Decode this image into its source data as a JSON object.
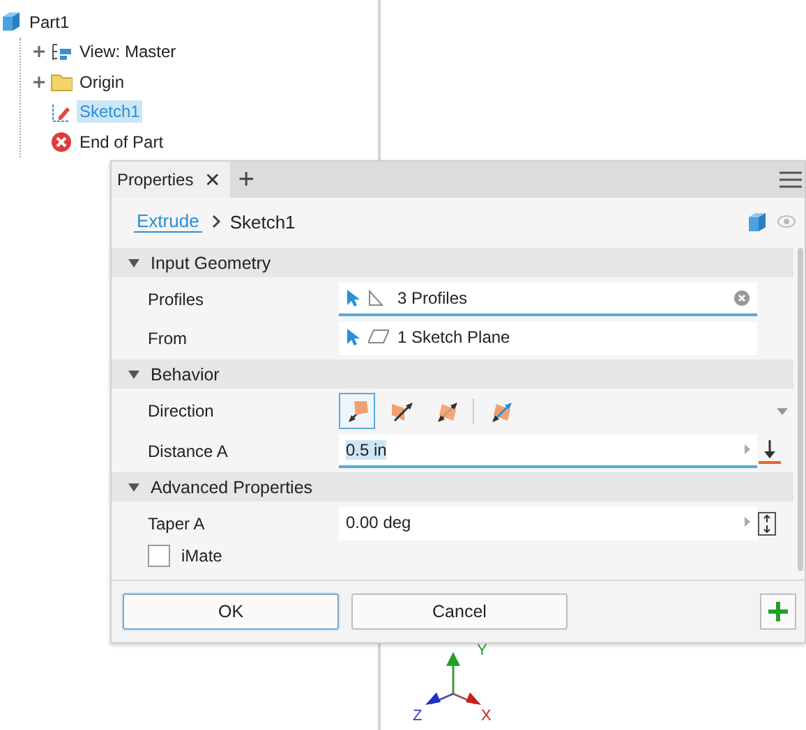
{
  "browser": {
    "tree": {
      "label": "Part1",
      "kind": "part",
      "children": [
        {
          "label": "View: Master",
          "kind": "view",
          "expanded": false,
          "selected": false
        },
        {
          "label": "Origin",
          "kind": "folder",
          "expanded": false,
          "selected": false
        },
        {
          "label": "Sketch1",
          "kind": "sketch",
          "selected": true
        },
        {
          "label": "End of Part",
          "kind": "end",
          "selected": false
        }
      ]
    }
  },
  "properties": {
    "tab": {
      "label": "Properties",
      "close": "✕",
      "add": "+"
    },
    "breadcrumb": {
      "link": "Extrude",
      "current": "Sketch1"
    },
    "sections": [
      {
        "title": "Input Geometry",
        "expanded": true,
        "rows": [
          {
            "kind": "profile-selector",
            "label": "Profiles",
            "value": "3 Profiles",
            "active": true
          },
          {
            "kind": "plane-selector",
            "label": "From",
            "value": "1 Sketch Plane",
            "active": false
          }
        ]
      },
      {
        "title": "Behavior",
        "expanded": true,
        "rows": [
          {
            "kind": "direction",
            "label": "Direction",
            "options": [
              {
                "kind": "default",
                "selected": true
              },
              {
                "kind": "flipped",
                "selected": false
              },
              {
                "kind": "symmetric",
                "selected": false
              },
              {
                "kind": "asymmetric",
                "selected": false
              }
            ]
          },
          {
            "kind": "distance",
            "label": "Distance A",
            "value": "0.5 in",
            "active": true
          }
        ]
      },
      {
        "title": "Advanced Properties",
        "expanded": true,
        "rows": [
          {
            "kind": "angle",
            "label": "Taper A",
            "value": "0.00 deg",
            "active": false
          },
          {
            "kind": "checkbox",
            "label": "iMate",
            "checked": false
          }
        ]
      }
    ],
    "buttons": [
      {
        "label": "OK",
        "default": true
      },
      {
        "label": "Cancel",
        "default": false
      }
    ]
  },
  "viewport": {
    "axes": {
      "x": "X",
      "y": "Y",
      "z": "Z"
    }
  }
}
